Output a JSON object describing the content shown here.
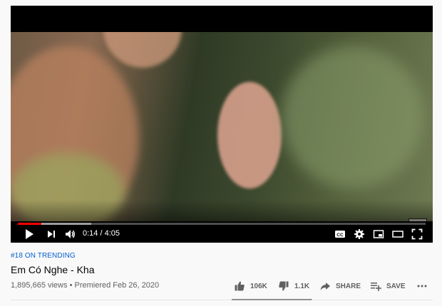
{
  "player": {
    "current_time": "0:14",
    "separator": "/",
    "duration": "4:05",
    "played_fraction": 0.057,
    "buffered_fraction": 0.18,
    "icons": {
      "play": "play-icon",
      "next": "next-icon",
      "volume": "volume-icon",
      "captions": "captions-icon",
      "settings": "gear-icon",
      "miniplayer": "miniplayer-icon",
      "theater": "theater-icon",
      "fullscreen": "fullscreen-icon"
    }
  },
  "video": {
    "trending": "#18 ON TRENDING",
    "title": "Em Có Nghe - Kha",
    "views": "1,895,665 views",
    "premiered": "Premiered Feb 26, 2020"
  },
  "actions": {
    "likes": "106K",
    "dislikes": "1.1K",
    "share": "SHARE",
    "save": "SAVE",
    "like_ratio": 0.99
  },
  "colors": {
    "accent": "#ff0000",
    "link": "#065fd4",
    "text": "#030303",
    "muted": "#606060"
  }
}
